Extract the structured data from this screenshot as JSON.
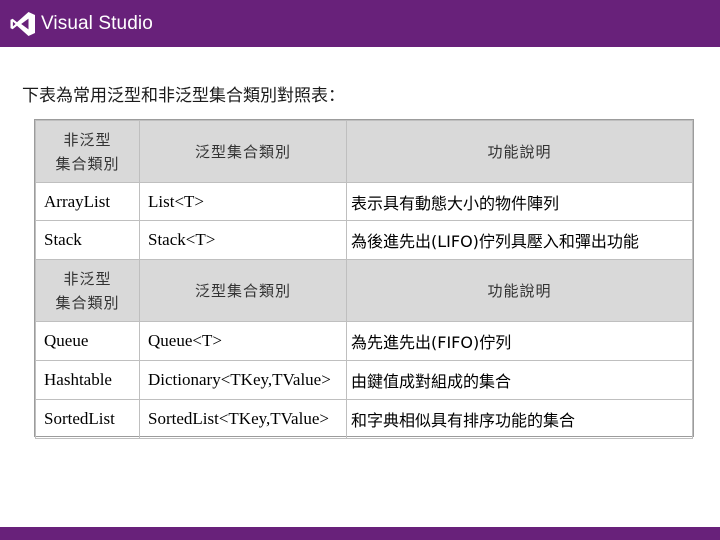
{
  "brand": {
    "name": "Visual Studio",
    "icon": "visual-studio-logo-icon",
    "color": "#68217a"
  },
  "heading": "下表為常用泛型和非泛型集合類別對照表：",
  "table": {
    "header": {
      "col1_line1": "非泛型",
      "col1_line2": "集合類別",
      "col2": "泛型集合類別",
      "col3": "功能說明"
    },
    "rows": [
      {
        "nongeneric": "ArrayList",
        "generic": "List<T>",
        "desc": "表示具有動態大小的物件陣列"
      },
      {
        "nongeneric": "Stack",
        "generic": "Stack<T>",
        "desc": "為後進先出(LIFO)佇列具壓入和彈出功能"
      },
      {
        "nongeneric": "Queue",
        "generic": "Queue<T>",
        "desc": "為先進先出(FIFO)佇列"
      },
      {
        "nongeneric": "Hashtable",
        "generic": "Dictionary<TKey,TValue>",
        "desc": "由鍵值成對組成的集合"
      },
      {
        "nongeneric": "SortedList",
        "generic": "SortedList<TKey,TValue>",
        "desc": "和字典相似具有排序功能的集合"
      }
    ]
  }
}
